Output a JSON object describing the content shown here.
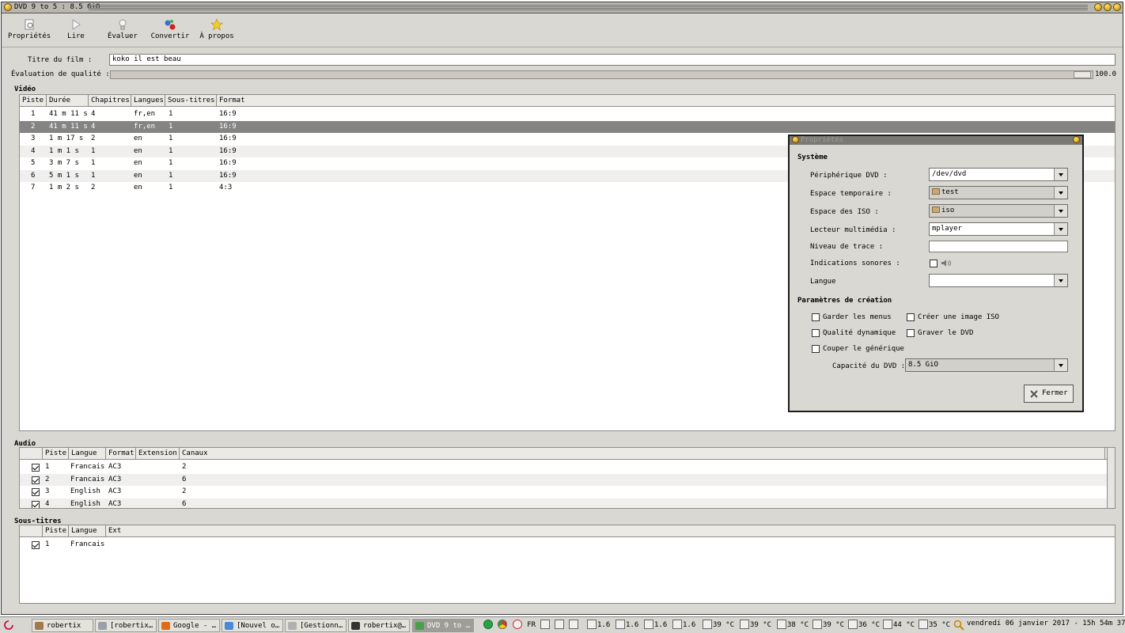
{
  "window": {
    "title": "DVD 9 to 5 : 8.5 GiO"
  },
  "toolbar": {
    "properties": "Propriétés",
    "play": "Lire",
    "evaluate": "Évaluer",
    "convert": "Convertir",
    "about": "À propos"
  },
  "form": {
    "title_label": "Titre du film :",
    "title_value": "koko il est beau",
    "quality_label": "Évaluation de qualité :",
    "quality_value": "100.0",
    "quality_fraction": 1.0
  },
  "video": {
    "section": "Vidéo",
    "columns": [
      "Piste",
      "Durée",
      "Chapitres",
      "Langues",
      "Sous-titres",
      "Format"
    ],
    "rows": [
      [
        "1",
        "41 m 11 s",
        "4",
        "fr,en",
        "1",
        "16:9"
      ],
      [
        "2",
        "41 m 11 s",
        "4",
        "fr,en",
        "1",
        "16:9"
      ],
      [
        "3",
        "1 m 17 s",
        "2",
        "en",
        "1",
        "16:9"
      ],
      [
        "4",
        "1 m 1 s",
        "1",
        "en",
        "1",
        "16:9"
      ],
      [
        "5",
        "3 m 7 s",
        "1",
        "en",
        "1",
        "16:9"
      ],
      [
        "6",
        "5 m 1 s",
        "1",
        "en",
        "1",
        "16:9"
      ],
      [
        "7",
        "1 m 2 s",
        "2",
        "en",
        "1",
        "4:3"
      ]
    ],
    "selected_row": 1
  },
  "audio": {
    "section": "Audio",
    "columns": [
      "Piste",
      "Langue",
      "Format",
      "Extension",
      "Canaux"
    ],
    "rows": [
      [
        "1",
        "Francais",
        "AC3",
        "",
        "2"
      ],
      [
        "2",
        "Francais",
        "AC3",
        "",
        "6"
      ],
      [
        "3",
        "English",
        "AC3",
        "",
        "2"
      ],
      [
        "4",
        "English",
        "AC3",
        "",
        "6"
      ]
    ]
  },
  "subtitles": {
    "section": "Sous-titres",
    "columns": [
      "Piste",
      "Langue",
      "Ext"
    ],
    "rows": [
      [
        "1",
        "Francais",
        ""
      ]
    ]
  },
  "dialog": {
    "title": "Propriétés",
    "system_heading": "Système",
    "dvd_device_label": "Périphérique DVD :",
    "dvd_device_value": "/dev/dvd",
    "temp_space_label": "Espace temporaire :",
    "temp_space_value": "test",
    "iso_space_label": "Espace des ISO :",
    "iso_space_value": "iso",
    "player_label": "Lecteur multimédia :",
    "player_value": "mplayer",
    "trace_label": "Niveau de trace :",
    "trace_value": "",
    "sound_label": "Indications sonores :",
    "language_label": "Langue",
    "language_value": "",
    "creation_heading": "Paramètres de création",
    "keep_menus": "Garder les menus",
    "create_iso": "Créer une image ISO",
    "dynamic_quality": "Qualité dynamique",
    "burn_dvd": "Graver le DVD",
    "cut_credits": "Couper le générique",
    "capacity_label": "Capacité du DVD :",
    "capacity_value": "8.5 GiO",
    "close": "Fermer"
  },
  "taskbar": {
    "tasks": [
      "robertix",
      "[robertix…",
      "Google - …",
      "[Nouvel o…",
      "[Gestionn…",
      "robertix@…",
      "DVD 9 to …"
    ],
    "lang": "FR",
    "cpu": [
      "1.6",
      "1.6",
      "1.6",
      "1.6"
    ],
    "temps": [
      "39 °C",
      "39 °C",
      "38 °C",
      "39 °C",
      "36 °C",
      "44 °C",
      "35 °C"
    ],
    "clock": "vendredi 06 janvier 2017 - 15h 54m 37s"
  }
}
